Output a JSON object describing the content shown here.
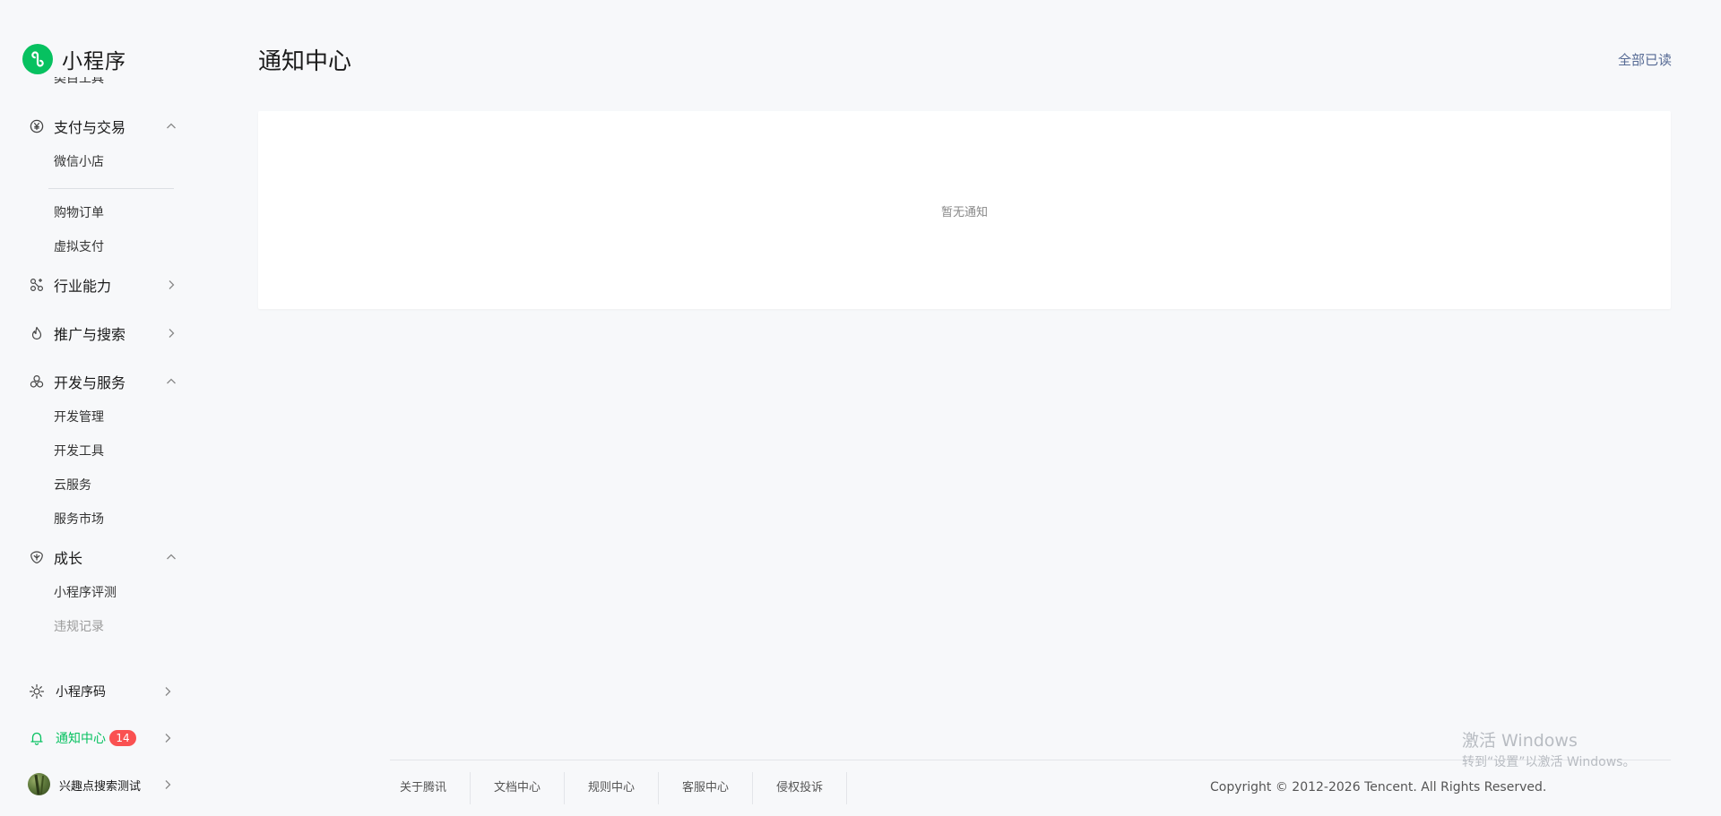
{
  "brand": {
    "name": "小程序",
    "accent": "#07c160"
  },
  "sidebar": {
    "cut_item_label": "类目工具",
    "groups": {
      "payment": {
        "label": "支付与交易",
        "icon": "yen-circle-icon",
        "expanded": true,
        "items": [
          {
            "label": "微信小店"
          },
          {
            "label": "购物订单"
          },
          {
            "label": "虚拟支付"
          }
        ]
      },
      "industry": {
        "label": "行业能力",
        "icon": "industry-nodes-icon",
        "expanded": false
      },
      "promotion": {
        "label": "推广与搜索",
        "icon": "flame-icon",
        "expanded": false
      },
      "dev": {
        "label": "开发与服务",
        "icon": "cluster-icon",
        "expanded": true,
        "items": [
          {
            "label": "开发管理"
          },
          {
            "label": "开发工具"
          },
          {
            "label": "云服务"
          },
          {
            "label": "服务市场"
          }
        ]
      },
      "growth": {
        "label": "成长",
        "icon": "growth-icon",
        "expanded": true,
        "items": [
          {
            "label": "小程序评测"
          },
          {
            "label": "违规记录"
          }
        ]
      }
    },
    "bottom": {
      "qrcode": {
        "label": "小程序码",
        "icon": "miniprogram-code-icon"
      },
      "notifications": {
        "label": "通知中心",
        "icon": "bell-icon",
        "badge": "14",
        "active": true
      },
      "account": {
        "label": "兴趣点搜索测试"
      }
    }
  },
  "main": {
    "title": "通知中心",
    "mark_all_read": "全部已读",
    "empty_text": "暂无通知"
  },
  "footer": {
    "links": [
      "关于腾讯",
      "文档中心",
      "规则中心",
      "客服中心",
      "侵权投诉"
    ],
    "copyright": "Copyright © 2012-2026 Tencent. All Rights Reserved."
  },
  "watermark": {
    "line1": "激活 Windows",
    "line2": "转到“设置”以激活 Windows。"
  },
  "colors": {
    "badge": "#fa5151",
    "link": "#576b95",
    "background": "#f7f8fa"
  }
}
